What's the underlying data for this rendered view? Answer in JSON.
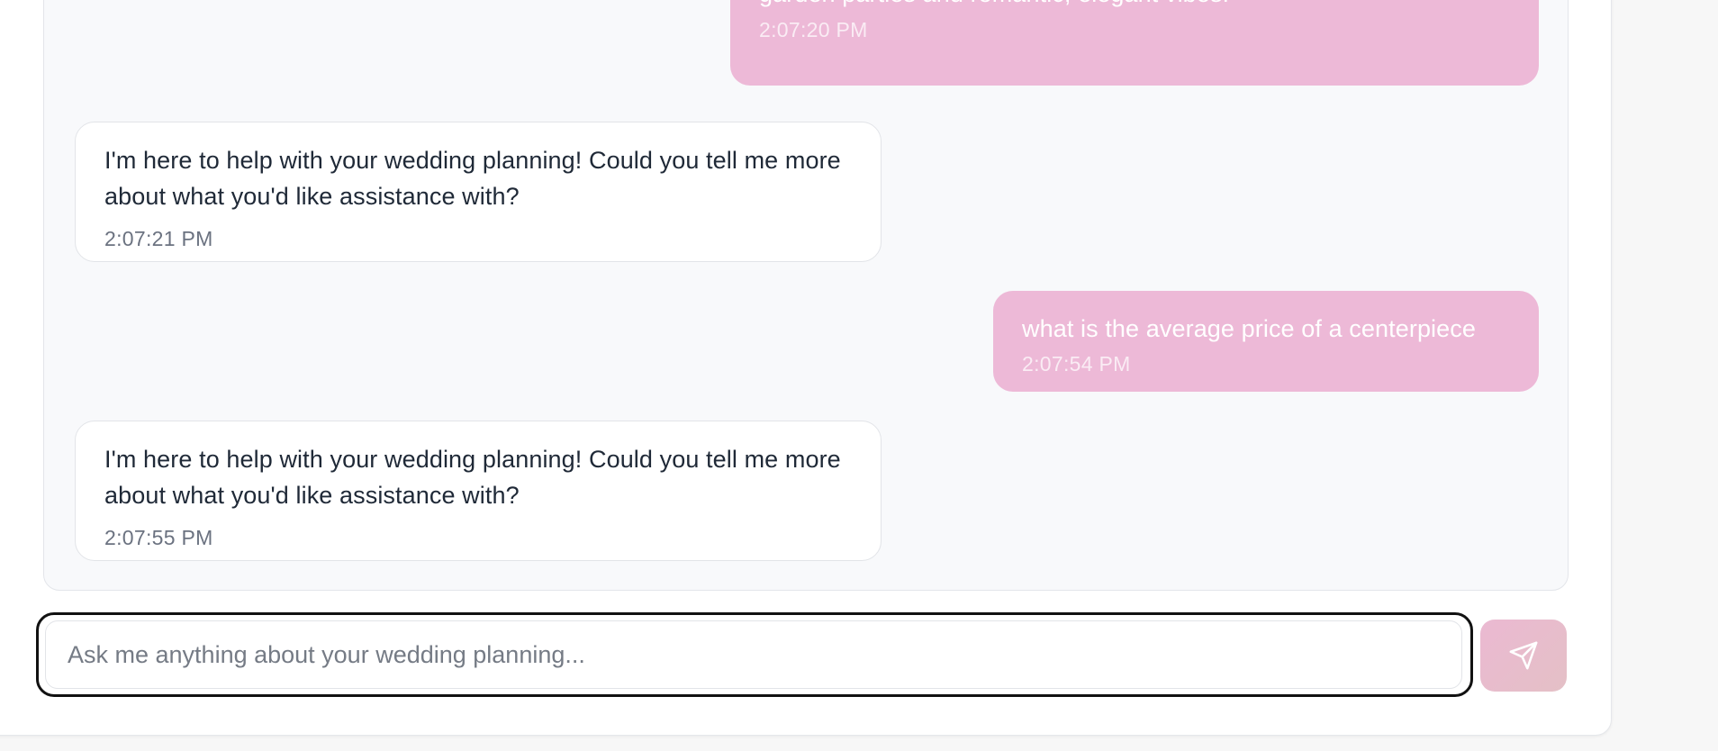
{
  "messages": [
    {
      "role": "user",
      "text": "garden parties and romantic, elegant vibes.",
      "time": "2:07:20 PM"
    },
    {
      "role": "assistant",
      "text": "I'm here to help with your wedding planning! Could you tell me more about what you'd like assistance with?",
      "time": "2:07:21 PM"
    },
    {
      "role": "user",
      "text": "what is the average price of a centerpiece",
      "time": "2:07:54 PM"
    },
    {
      "role": "assistant",
      "text": "I'm here to help with your wedding planning! Could you tell me more about what you'd like assistance with?",
      "time": "2:07:55 PM"
    }
  ],
  "composer": {
    "placeholder": "Ask me anything about your wedding planning...",
    "value": "",
    "send_icon": "send-icon"
  },
  "colors": {
    "user_bubble": "#edb9d7",
    "assistant_bubble": "#ffffff",
    "send_button": "#ebb9d2"
  }
}
